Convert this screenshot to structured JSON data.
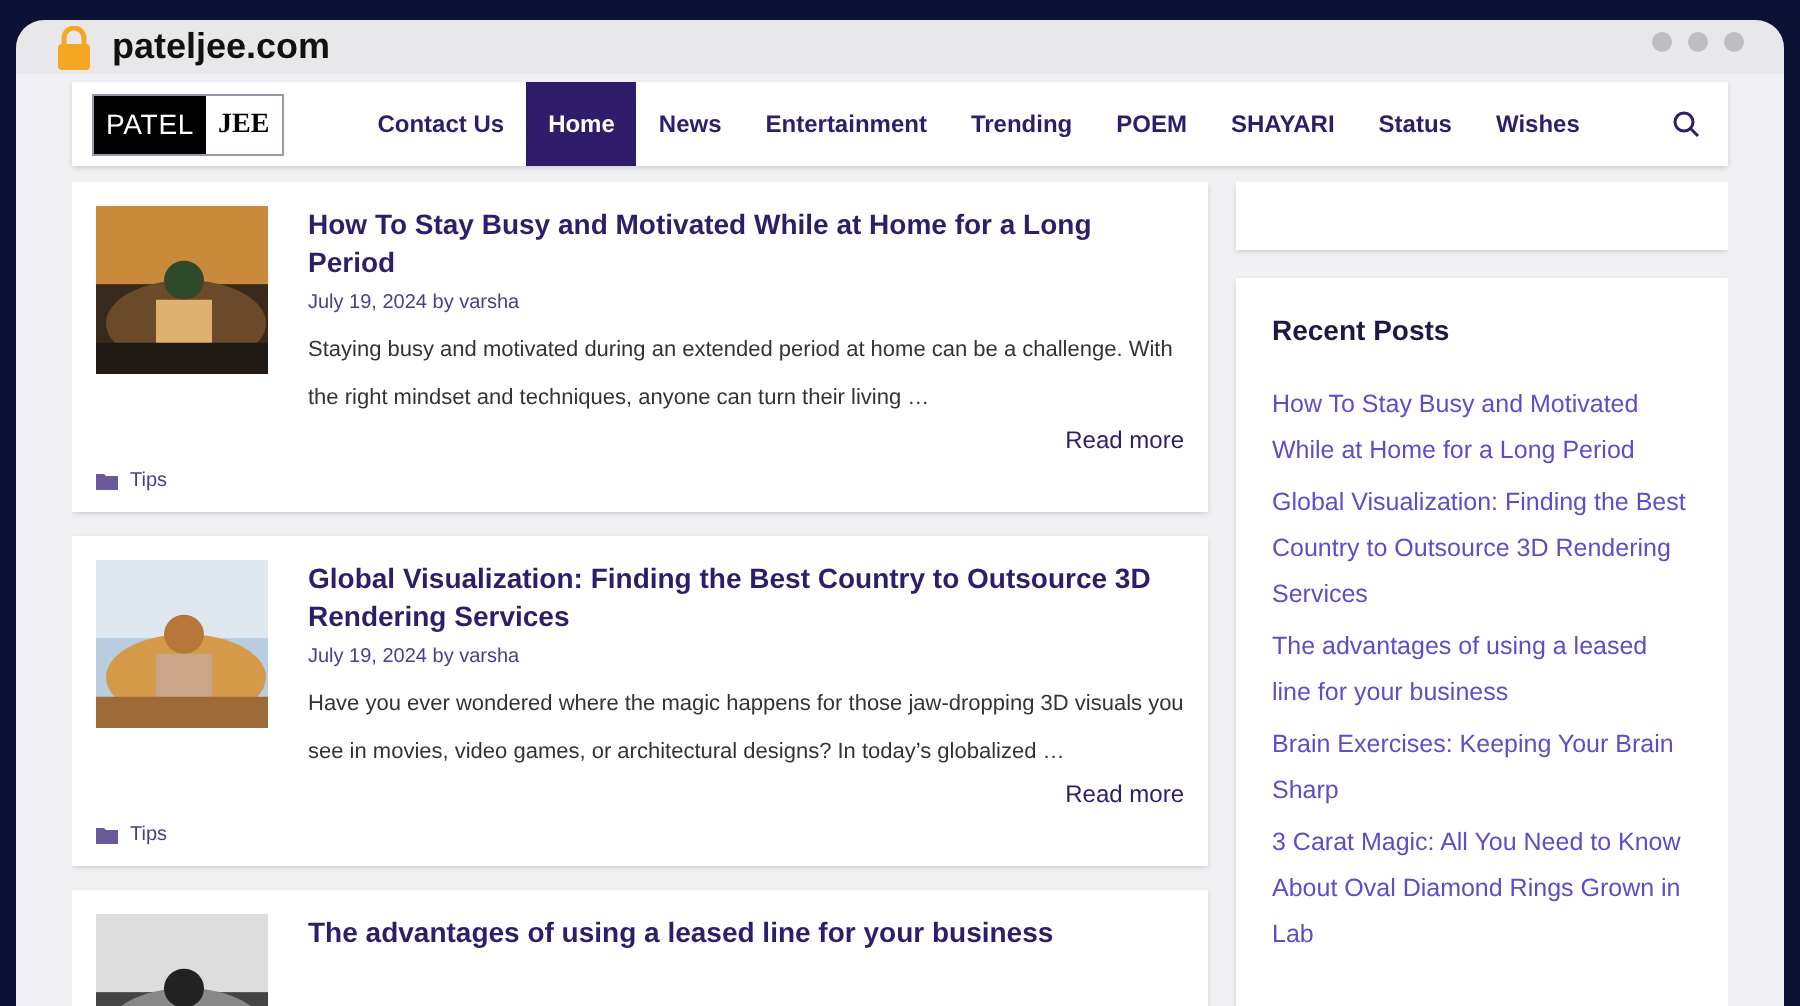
{
  "browser": {
    "url": "pateljee.com"
  },
  "logo": {
    "part_1": "PATEL",
    "part_2": "JEE"
  },
  "nav": [
    {
      "label": "Contact Us",
      "selected": false
    },
    {
      "label": "Home",
      "selected": true
    },
    {
      "label": "News",
      "selected": false
    },
    {
      "label": "Entertainment",
      "selected": false
    },
    {
      "label": "Trending",
      "selected": false
    },
    {
      "label": "POEM",
      "selected": false
    },
    {
      "label": "SHAYARI",
      "selected": false
    },
    {
      "label": "Status",
      "selected": false
    },
    {
      "label": "Wishes",
      "selected": false
    }
  ],
  "posts": [
    {
      "title": "How To Stay Busy and Motivated While at Home for a Long Period",
      "meta": "July 19, 2024 by varsha",
      "excerpt": "Staying busy and motivated during an extended period at home can be a challenge. With the right mindset and techniques, anyone can turn their living …",
      "read_more": "Read more",
      "category": "Tips"
    },
    {
      "title": "Global Visualization: Finding the Best Country to Outsource 3D Rendering Services",
      "meta": "July 19, 2024 by varsha",
      "excerpt": "Have you ever wondered where the magic happens for those jaw-dropping 3D visuals you see in movies, video games, or architectural designs? In today’s globalized …",
      "read_more": "Read more",
      "category": "Tips"
    },
    {
      "title": "The advantages of using a leased line for your business"
    }
  ],
  "recent_posts": {
    "title": "Recent Posts",
    "items": [
      "How To Stay Busy and Motivated While at Home for a Long Period",
      "Global Visualization: Finding the Best Country to Outsource 3D Rendering Services",
      "The advantages of using a leased line for your business",
      "Brain Exercises: Keeping Your Brain Sharp",
      "3 Carat Magic: All You Need to Know About Oval Diamond Rings Grown in Lab"
    ]
  }
}
